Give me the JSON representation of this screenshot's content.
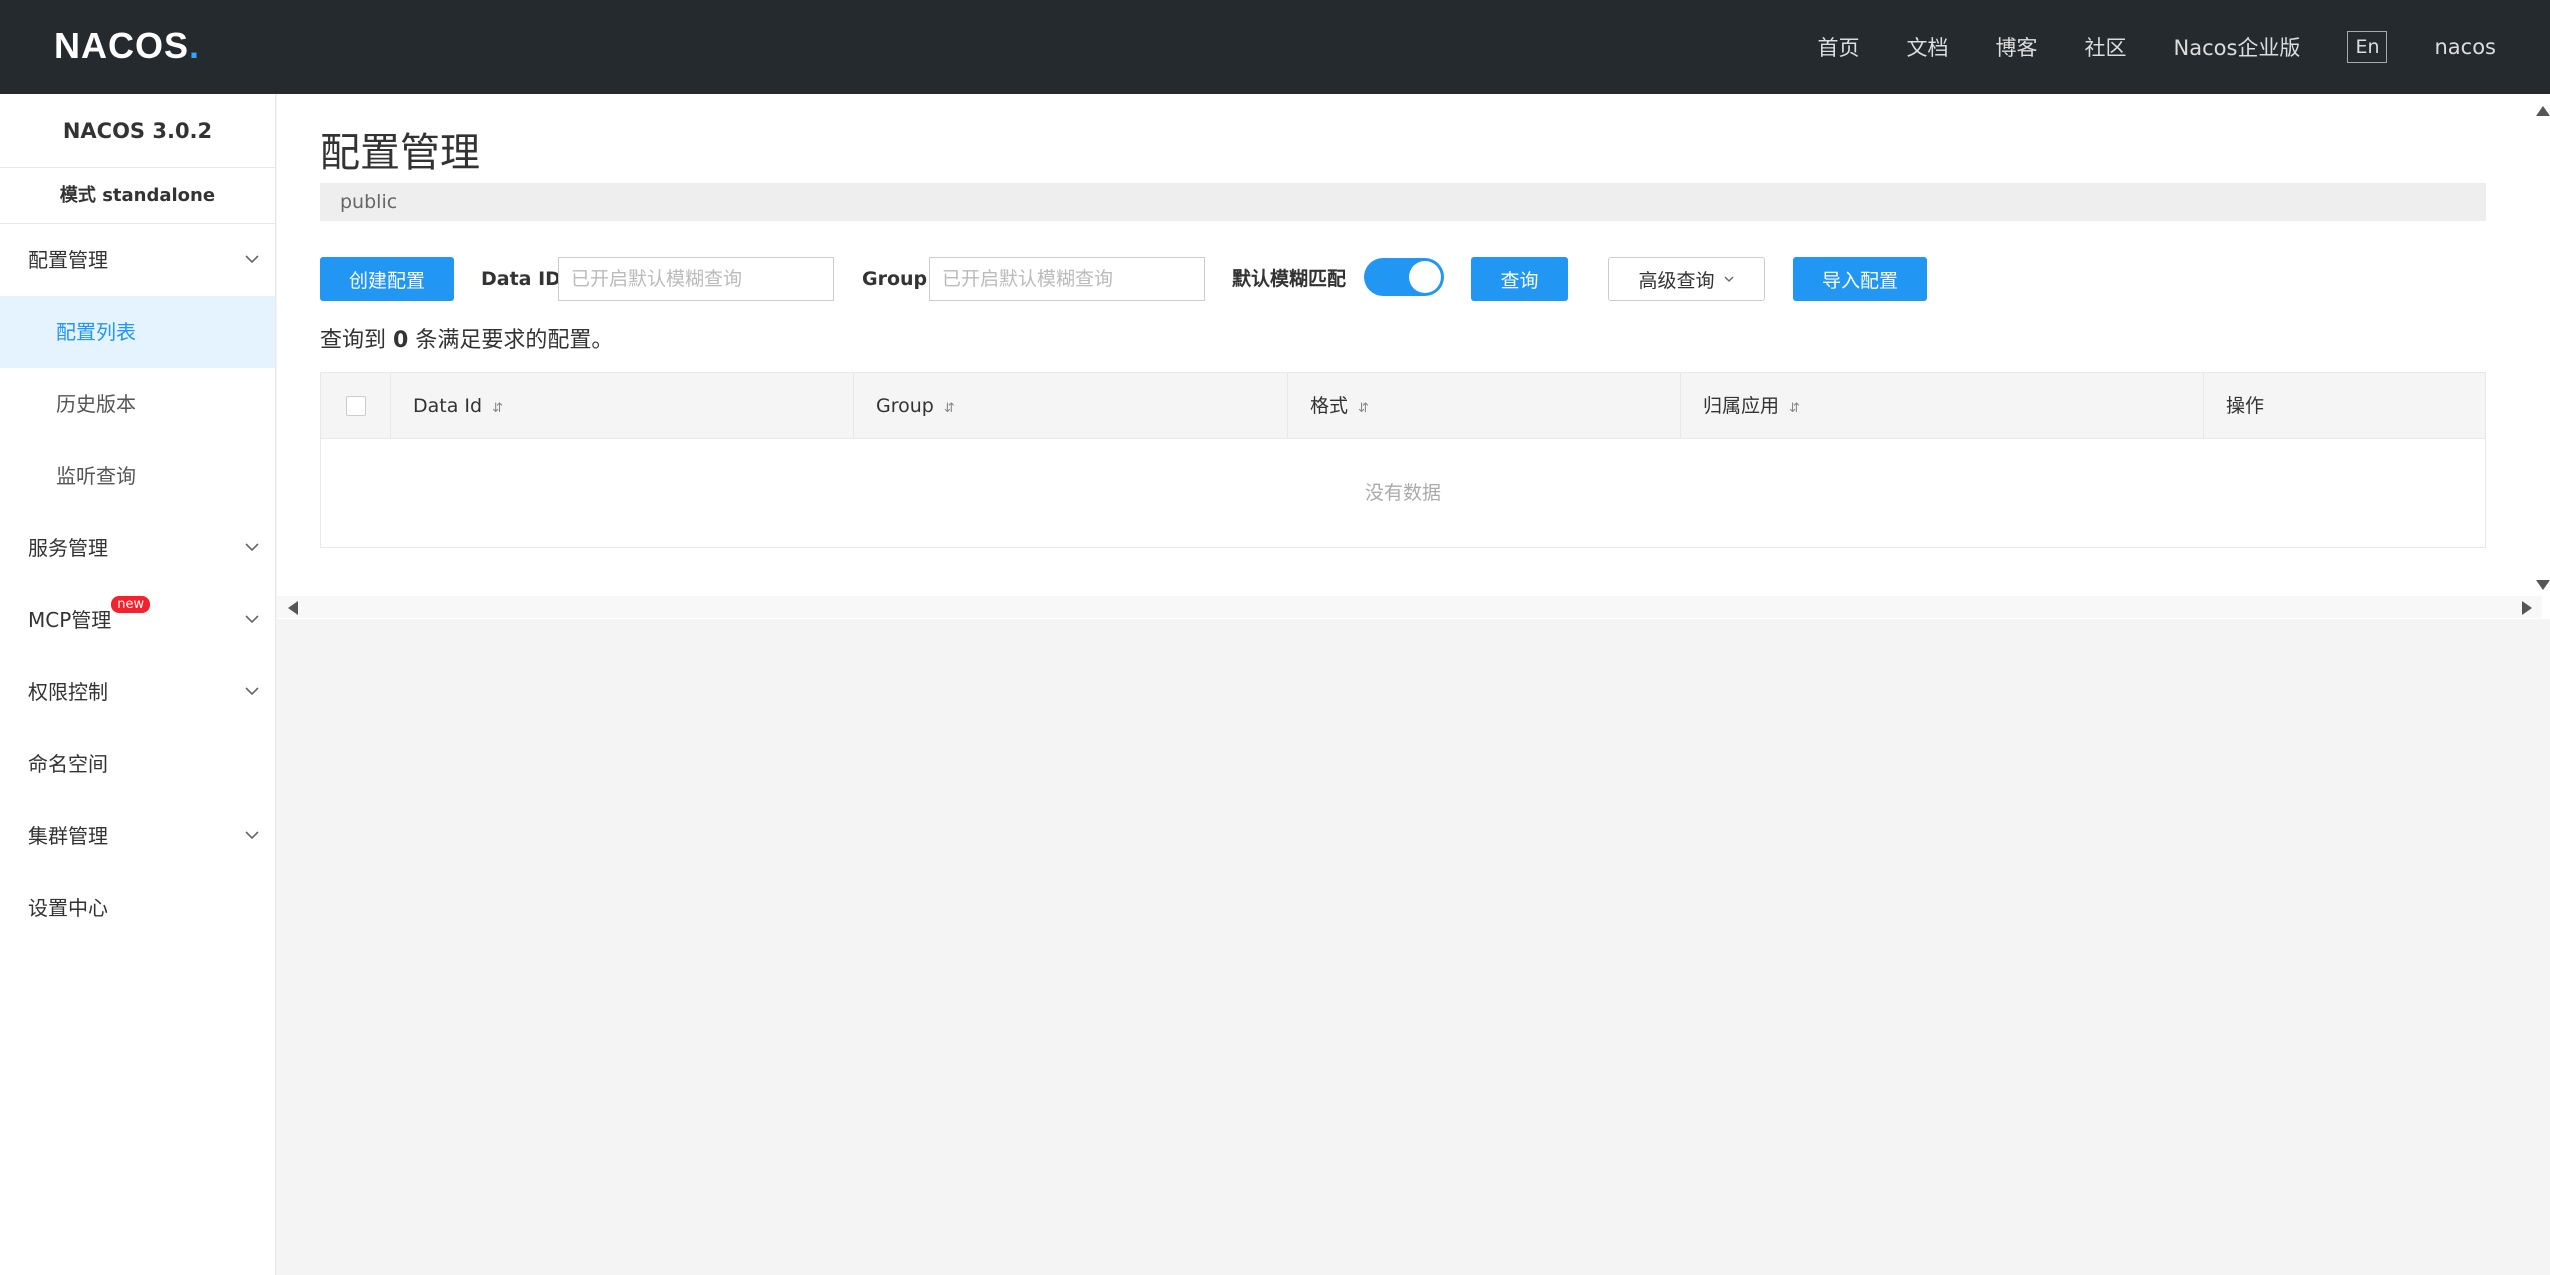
{
  "header": {
    "logo_text": "NACOS",
    "logo_dot": ".",
    "nav": [
      "首页",
      "文档",
      "博客",
      "社区",
      "Nacos企业版"
    ],
    "lang_button": "En",
    "user": "nacos"
  },
  "sidebar": {
    "version": "NACOS 3.0.2",
    "mode": "模式 standalone",
    "menu": {
      "config_mgmt": "配置管理",
      "config_list": "配置列表",
      "history": "历史版本",
      "listener_query": "监听查询",
      "service_mgmt": "服务管理",
      "mcp_mgmt": "MCP管理",
      "new_badge": "new",
      "access_control": "权限控制",
      "namespace": "命名空间",
      "cluster_mgmt": "集群管理",
      "settings": "设置中心"
    }
  },
  "main": {
    "title": "配置管理",
    "namespace": "public",
    "toolbar": {
      "create_button": "创建配置",
      "data_id_label": "Data ID",
      "data_id_placeholder": "已开启默认模糊查询",
      "group_label": "Group",
      "group_placeholder": "已开启默认模糊查询",
      "fuzzy_label": "默认模糊匹配",
      "fuzzy_enabled": true,
      "query_button": "查询",
      "advanced_button": "高级查询",
      "import_button": "导入配置"
    },
    "result": {
      "prefix": "查询到",
      "count": "0",
      "suffix": "条满足要求的配置。"
    },
    "table": {
      "columns": [
        "Data Id",
        "Group",
        "格式",
        "归属应用",
        "操作"
      ],
      "empty_text": "没有数据"
    }
  },
  "colors": {
    "topbar": "#252a2f",
    "primary": "#2196f3",
    "active_bg": "#e5f3ff",
    "badge": "#f5222d"
  }
}
